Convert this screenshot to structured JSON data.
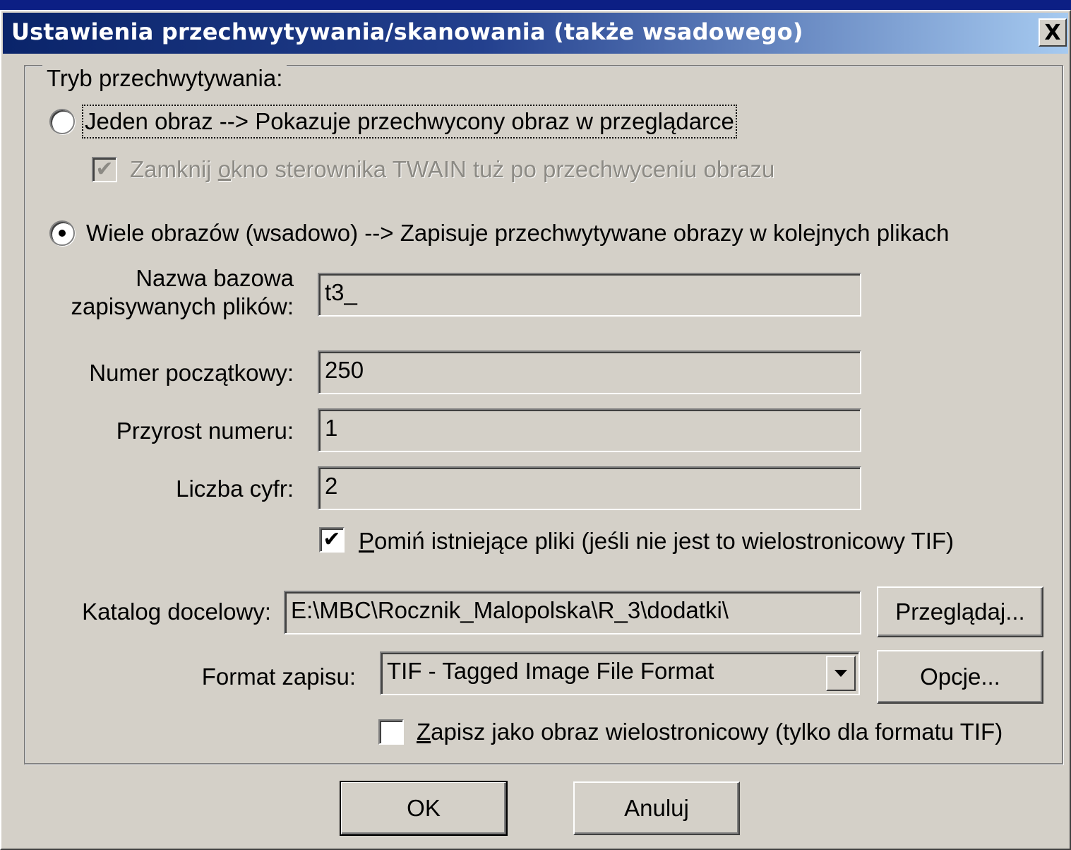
{
  "window": {
    "title": "Ustawienia przechwytywania/skanowania (także wsadowego)",
    "close_label": "X"
  },
  "group": {
    "legend": "Tryb przechwytywania:"
  },
  "mode": {
    "single_label": "Jeden obraz  -->  Pokazuje przechwycony obraz w przeglądarce",
    "single_selected": false,
    "close_twain": {
      "label_pre": "Zamknij ",
      "label_key": "o",
      "label_post": "kno sterownika TWAIN tuż po przechwyceniu obrazu",
      "checked": true,
      "enabled": false
    },
    "batch_label": "Wiele obrazów (wsadowo)  -->  Zapisuje przechwytywane obrazy w kolejnych plikach",
    "batch_selected": true
  },
  "fields": {
    "base_name_label_line1": "Nazwa bazowa",
    "base_name_label_line2": "zapisywanych plików:",
    "base_name_value": "t3_",
    "start_number_label": "Numer początkowy:",
    "start_number_value": "250",
    "increment_label": "Przyrost numeru:",
    "increment_value": "1",
    "digits_label": "Liczba cyfr:",
    "digits_value": "2"
  },
  "skip_existing": {
    "label_key": "P",
    "label_post": "omiń istniejące pliki (jeśli nie jest to wielostronicowy TIF)",
    "checked": true
  },
  "target_dir": {
    "label": "Katalog docelowy:",
    "value": "E:\\MBC\\Rocznik_Malopolska\\R_3\\dodatki\\",
    "browse_label": "Przeglądaj..."
  },
  "save_format": {
    "label": "Format zapisu:",
    "selected": "TIF - Tagged Image File Format",
    "options_label": "Opcje..."
  },
  "multipage": {
    "label_key": "Z",
    "label_post": "apisz jako obraz wielostronicowy (tylko dla formatu TIF)",
    "checked": false
  },
  "buttons": {
    "ok": "OK",
    "cancel": "Anuluj"
  },
  "colors": {
    "titlebar_start": "#0a246a",
    "titlebar_end": "#a6caf0",
    "dialog_bg": "#d4d0c8"
  }
}
